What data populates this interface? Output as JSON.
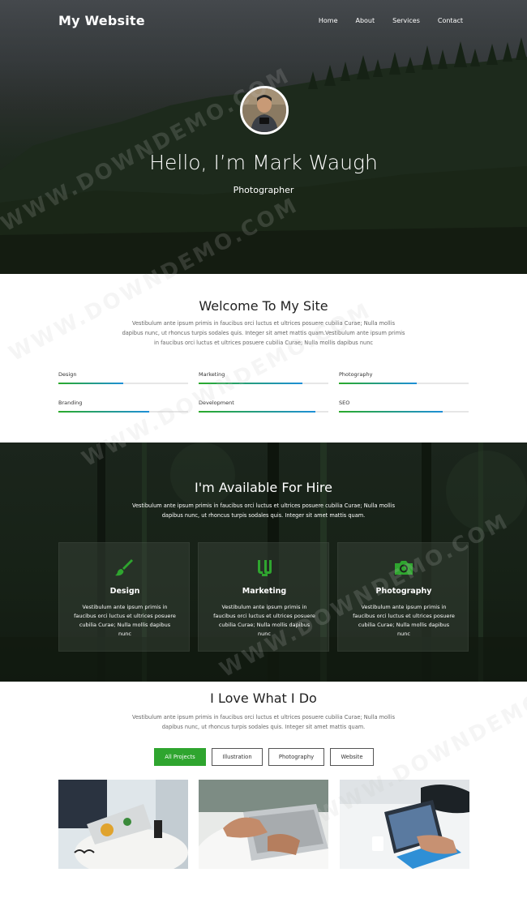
{
  "nav": {
    "logo": "My Website",
    "items": [
      "Home",
      "About",
      "Services",
      "Contact"
    ]
  },
  "hero": {
    "title": "Hello, I’m Mark Waugh",
    "subtitle": "Photographer"
  },
  "welcome": {
    "title": "Welcome To My Site",
    "text": "Vestibulum ante ipsum primis in faucibus orci luctus et ultrices posuere cubilia Curae; Nulla mollis dapibus nunc, ut rhoncus turpis sodales quis. Integer sit amet mattis quam.Vestibulum ante ipsum primis in faucibus orci luctus et ultrices posuere cubilia Curae; Nulla mollis dapibus nunc",
    "skills": [
      {
        "label": "Design",
        "percent": 50
      },
      {
        "label": "Marketing",
        "percent": 80
      },
      {
        "label": "Photography",
        "percent": 60
      },
      {
        "label": "Branding",
        "percent": 70
      },
      {
        "label": "Development",
        "percent": 90
      },
      {
        "label": "SEO",
        "percent": 80
      }
    ]
  },
  "hire": {
    "title": "I'm Available For Hire",
    "text": "Vestibulum ante ipsum primis in faucibus orci luctus et ultrices posuere cubilia Curae; Nulla mollis dapibus nunc, ut rhoncus turpis sodales quis. Integer sit amet mattis quam.",
    "cards": [
      {
        "icon": "paint-brush-icon",
        "title": "Design",
        "text": "Vestibulum ante ipsum primis in faucibus orci luctus et ultrices posuere cubilia Curae; Nulla mollis dapibus nunc"
      },
      {
        "icon": "marketing-icon",
        "title": "Marketing",
        "text": "Vestibulum ante ipsum primis in faucibus orci luctus et ultrices posuere cubilia Curae; Nulla mollis dapibus nunc"
      },
      {
        "icon": "camera-icon",
        "title": "Photography",
        "text": "Vestibulum ante ipsum primis in faucibus orci luctus et ultrices posuere cubilia Curae; Nulla mollis dapibus nunc"
      }
    ]
  },
  "work": {
    "title": "I Love What I Do",
    "text": "Vestibulum ante ipsum primis in faucibus orci luctus et ultrices posuere cubilia Curae; Nulla mollis dapibus nunc, ut rhoncus turpis sodales quis. Integer sit amet mattis quam.",
    "filters": [
      "All Projects",
      "Illustration",
      "Photography",
      "Website"
    ],
    "active_filter": "All Projects"
  },
  "watermark": "WWW.DOWNDEMO.COM",
  "colors": {
    "accent": "#2fa52f",
    "progress_start": "#2aaa2a",
    "progress_end": "#1e8fd8"
  }
}
